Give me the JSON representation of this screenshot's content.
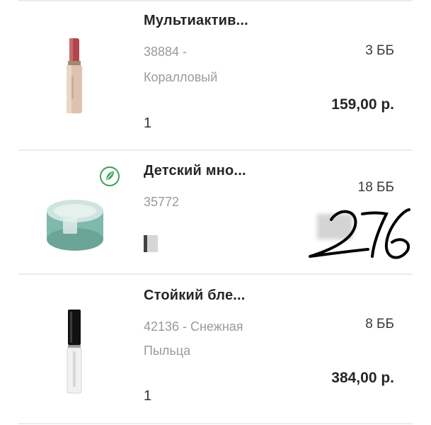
{
  "items": [
    {
      "name": "Мультиактив...",
      "sku": "38884 -",
      "shade": "Коралловый",
      "bb": "3 ББ",
      "price": "159,00 р.",
      "qty": "1",
      "icon": "lipstick-icon"
    },
    {
      "name": "Детский мно...",
      "sku": "35772",
      "shade": "",
      "bb": "18 ББ",
      "price": "",
      "qty": "",
      "icon": "cream-jar-icon",
      "badge_icon": "eco-leaf-icon",
      "handwritten": "276"
    },
    {
      "name": "Стойкий бле...",
      "sku": "42136 - Снежная",
      "shade": "Пыльца",
      "bb": "8 ББ",
      "price": "384,00 р.",
      "qty": "1",
      "icon": "lip-gloss-icon"
    }
  ],
  "colors": {
    "accent_green": "#3aa05a",
    "jar_teal": "#7fb8ac",
    "lipstick_red": "#b0464b"
  }
}
